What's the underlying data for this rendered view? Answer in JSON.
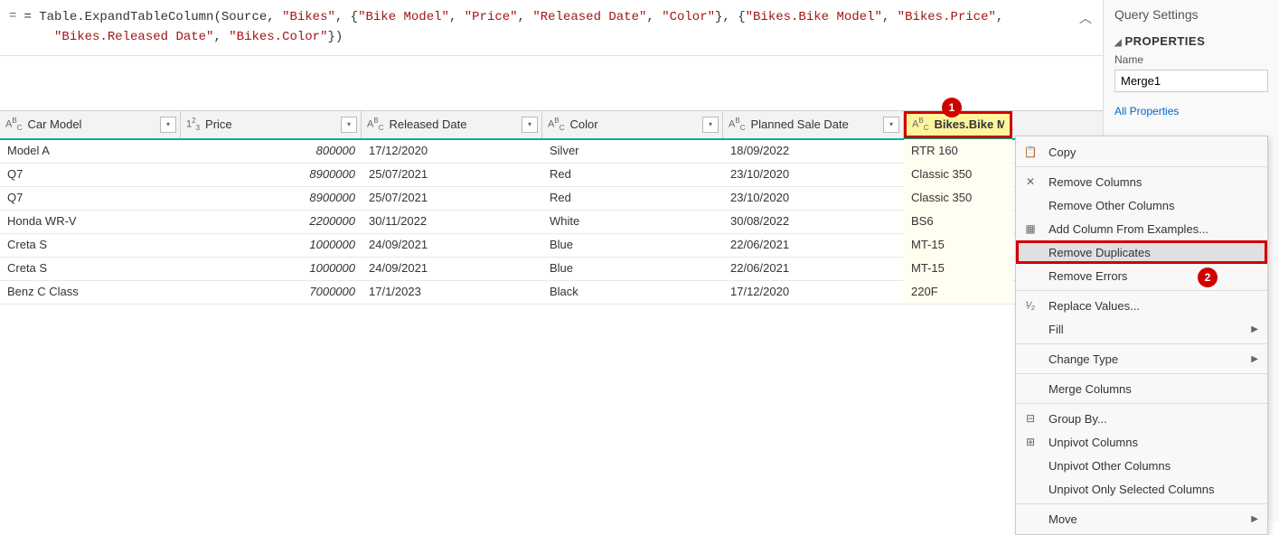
{
  "formula": {
    "prefix": "= Table.ExpandTableColumn(Source, ",
    "s1": "\"Bikes\"",
    "mid1": ", {",
    "s2": "\"Bike Model\"",
    "c": ", ",
    "s3": "\"Price\"",
    "s4": "\"Released Date\"",
    "s5": "\"Color\"",
    "mid2": "}, {",
    "s6": "\"Bikes.Bike Model\"",
    "s7": "\"Bikes.Price\"",
    "break": ",\n    ",
    "s8": "\"Bikes.Released Date\"",
    "s9": "\"Bikes.Color\"",
    "suffix": "})"
  },
  "columns": [
    {
      "type": "ABC",
      "label": "Car Model"
    },
    {
      "type": "123",
      "label": "Price"
    },
    {
      "type": "ABC",
      "label": "Released Date"
    },
    {
      "type": "ABC",
      "label": "Color"
    },
    {
      "type": "ABC",
      "label": "Planned Sale Date"
    },
    {
      "type": "ABC",
      "label": "Bikes.Bike Model"
    }
  ],
  "rows": [
    {
      "c0": "Model A",
      "c1": "800000",
      "c2": "17/12/2020",
      "c3": "Silver",
      "c4": "18/09/2022",
      "c5": "RTR 160"
    },
    {
      "c0": "Q7",
      "c1": "8900000",
      "c2": "25/07/2021",
      "c3": "Red",
      "c4": "23/10/2020",
      "c5": "Classic 350"
    },
    {
      "c0": "Q7",
      "c1": "8900000",
      "c2": "25/07/2021",
      "c3": "Red",
      "c4": "23/10/2020",
      "c5": "Classic 350"
    },
    {
      "c0": "Honda WR-V",
      "c1": "2200000",
      "c2": "30/11/2022",
      "c3": "White",
      "c4": "30/08/2022",
      "c5": "BS6"
    },
    {
      "c0": "Creta S",
      "c1": "1000000",
      "c2": "24/09/2021",
      "c3": "Blue",
      "c4": "22/06/2021",
      "c5": "MT-15"
    },
    {
      "c0": "Creta S",
      "c1": "1000000",
      "c2": "24/09/2021",
      "c3": "Blue",
      "c4": "22/06/2021",
      "c5": "MT-15"
    },
    {
      "c0": "Benz C Class",
      "c1": "7000000",
      "c2": "17/1/2023",
      "c3": "Black",
      "c4": "17/12/2020",
      "c5": "220F"
    }
  ],
  "sidebar": {
    "title": "Query Settings",
    "properties": "PROPERTIES",
    "name_label": "Name",
    "name_value": "Merge1",
    "all_props": "All Properties"
  },
  "menu": {
    "copy": "Copy",
    "remove_cols": "Remove Columns",
    "remove_other": "Remove Other Columns",
    "add_col": "Add Column From Examples...",
    "remove_dup": "Remove Duplicates",
    "remove_err": "Remove Errors",
    "replace": "Replace Values...",
    "fill": "Fill",
    "change_type": "Change Type",
    "merge": "Merge Columns",
    "group": "Group By...",
    "unpivot": "Unpivot Columns",
    "unpivot_other": "Unpivot Other Columns",
    "unpivot_sel": "Unpivot Only Selected Columns",
    "move": "Move"
  },
  "badges": {
    "b1": "1",
    "b2": "2"
  }
}
